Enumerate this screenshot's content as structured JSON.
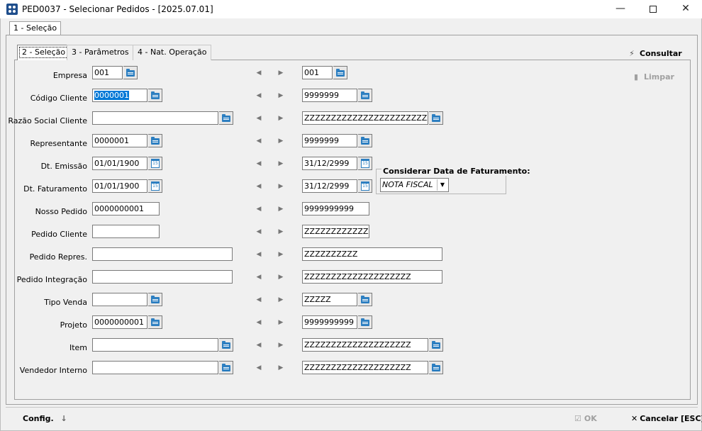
{
  "window": {
    "title": "PED0037 - Selecionar Pedidos - [2025.07.01]",
    "minimize": "—",
    "close": "✕"
  },
  "outer_tab": "1 - Seleção",
  "inner_tabs": [
    "2 - Seleção",
    "3 - Parâmetros",
    "4 - Nat. Operação"
  ],
  "side_buttons": {
    "consultar": "Consultar",
    "limpar": "Limpar"
  },
  "rows": [
    {
      "label": "Empresa",
      "from": "001",
      "to": "001",
      "btn": "folder"
    },
    {
      "label": "Código Cliente",
      "from": "0000001",
      "to": "9999999",
      "btn": "folder"
    },
    {
      "label": "Razão Social Cliente",
      "from": "",
      "to": "ZZZZZZZZZZZZZZZZZZZZZZZZZZZZZZ",
      "btn": "folder"
    },
    {
      "label": "Representante",
      "from": "0000001",
      "to": "9999999",
      "btn": "folder"
    },
    {
      "label": "Dt. Emissão",
      "from": "01/01/1900",
      "to": "31/12/2999",
      "btn": "calendar"
    },
    {
      "label": "Dt. Faturamento",
      "from": "01/01/1900",
      "to": "31/12/2999",
      "btn": "calendar"
    },
    {
      "label": "Nosso Pedido",
      "from": "0000000001",
      "to": "9999999999",
      "btn": ""
    },
    {
      "label": "Pedido Cliente",
      "from": "",
      "to": "ZZZZZZZZZZZZZZZ",
      "btn": ""
    },
    {
      "label": "Pedido Repres.",
      "from": "",
      "to": "ZZZZZZZZZZ",
      "btn": ""
    },
    {
      "label": "Pedido Integração",
      "from": "",
      "to": "ZZZZZZZZZZZZZZZZZZZZ",
      "btn": ""
    },
    {
      "label": "Tipo Venda",
      "from": "",
      "to": "ZZZZZ",
      "btn": "folder"
    },
    {
      "label": "Projeto",
      "from": "0000000001",
      "to": "9999999999",
      "btn": "folder"
    },
    {
      "label": "Item",
      "from": "",
      "to": "ZZZZZZZZZZZZZZZZZZZZ",
      "btn": "folder"
    },
    {
      "label": "Vendedor Interno",
      "from": "",
      "to": "ZZZZZZZZZZZZZZZZZZZZ",
      "btn": "folder"
    }
  ],
  "calendar_icon_text": "15",
  "faturamento_group": {
    "title": "Considerar Data de Faturamento:",
    "selected": "NOTA FISCAL"
  },
  "bottom": {
    "config": "Config.",
    "ok": "OK",
    "cancel": "Cancelar [ESC]"
  },
  "colors": {
    "selection": "#0078d7",
    "icon_blue": "#2d7fc1"
  }
}
